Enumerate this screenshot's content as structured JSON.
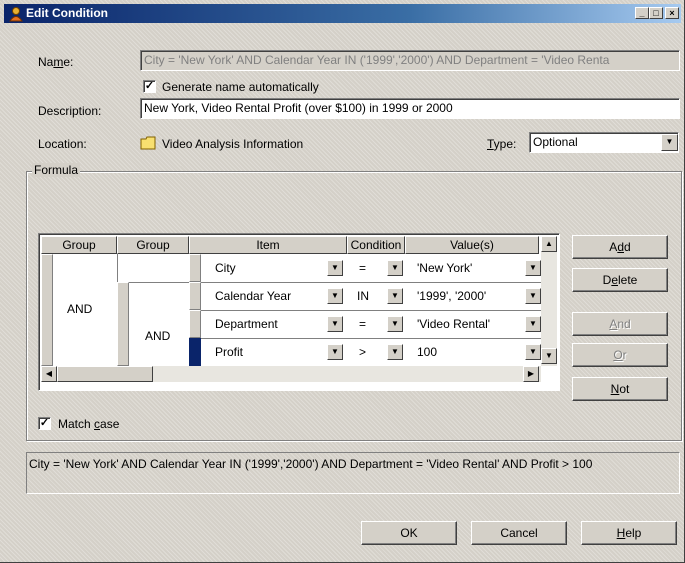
{
  "window": {
    "title": "Edit Condition"
  },
  "name": {
    "label": "Name:",
    "value": "City = 'New York' AND Calendar Year IN ('1999','2000') AND Department = 'Video Renta"
  },
  "generate_name": {
    "label": "Generate name automatically",
    "checked": true
  },
  "description": {
    "label": "Description:",
    "value": "New York, Video Rental Profit (over $100) in 1999 or 2000"
  },
  "location": {
    "label": "Location:",
    "value": "Video Analysis Information"
  },
  "type": {
    "label": "Type:",
    "value": "Optional"
  },
  "formula": {
    "title": "Formula",
    "headers": [
      "Group",
      "Group",
      "Item",
      "Condition",
      "Value(s)"
    ],
    "outer_group": "AND",
    "inner_group": "AND",
    "rows": [
      {
        "item": "City",
        "condition": "=",
        "value": "'New York'"
      },
      {
        "item": "Calendar Year",
        "condition": "IN",
        "value": "'1999', '2000'"
      },
      {
        "item": "Department",
        "condition": "=",
        "value": "'Video Rental'"
      },
      {
        "item": "Profit",
        "condition": ">",
        "value": "100"
      }
    ]
  },
  "buttons": {
    "add": "Add",
    "delete": "Delete",
    "and": "And",
    "or": "Or",
    "not": "Not",
    "ok": "OK",
    "cancel": "Cancel",
    "help": "Help"
  },
  "match_case": {
    "label": "Match case",
    "checked": true
  },
  "summary": "City = 'New York' AND Calendar Year IN ('1999','2000') AND Department = 'Video Rental' AND Profit > 100"
}
